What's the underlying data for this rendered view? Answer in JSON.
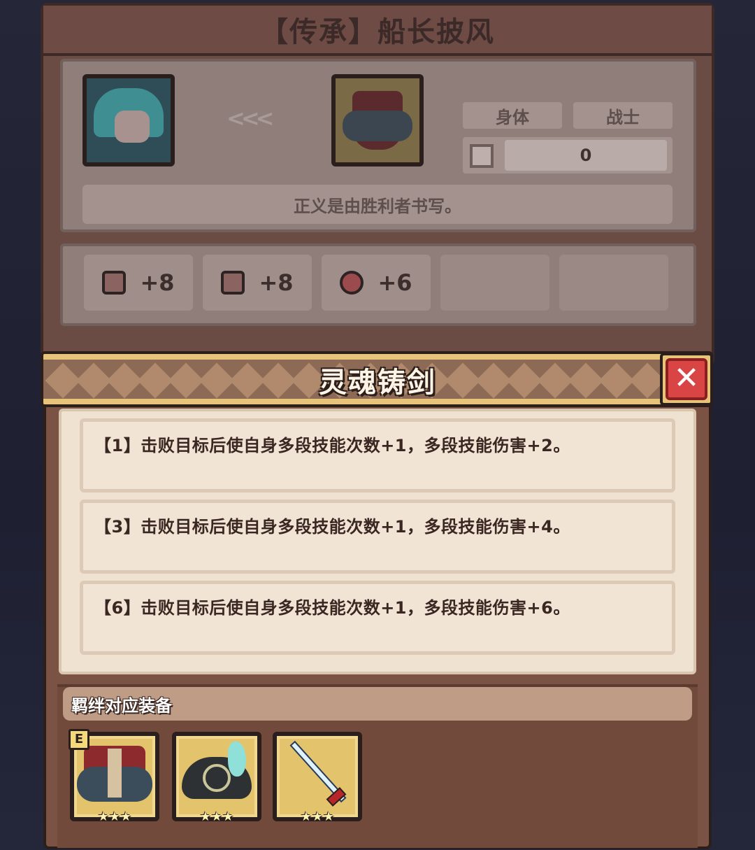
{
  "equipment_panel": {
    "title": "【传承】船长披风",
    "tags": [
      "身体",
      "战士"
    ],
    "power_value": "0",
    "quote": "正义是由胜利者书写。",
    "stats": [
      {
        "icon": "armor-icon",
        "value": "+8"
      },
      {
        "icon": "book-icon",
        "value": "+8"
      },
      {
        "icon": "heart-icon",
        "value": "+6"
      }
    ],
    "item_stars": "★★★"
  },
  "modal": {
    "title": "灵魂铸剑",
    "effects": [
      "【1】击败目标后使自身多段技能次数+1，多段技能伤害+2。",
      "【3】击败目标后使自身多段技能次数+1，多段技能伤害+4。",
      "【6】击败目标后使自身多段技能次数+1，多段技能伤害+6。"
    ],
    "bond_label": "羁绊对应装备",
    "equipped_badge": "E",
    "bond_items": [
      {
        "icon": "cloak-icon",
        "stars": "★★★"
      },
      {
        "icon": "pirate-hat-icon",
        "stars": "★★★"
      },
      {
        "icon": "sword-icon",
        "stars": "★★★"
      }
    ]
  },
  "colors": {
    "modal_bg": "#7a5344",
    "effect_card_bg": "#f1e4d5",
    "close_button": "#d94444",
    "gold_frame": "#e3c36c"
  }
}
